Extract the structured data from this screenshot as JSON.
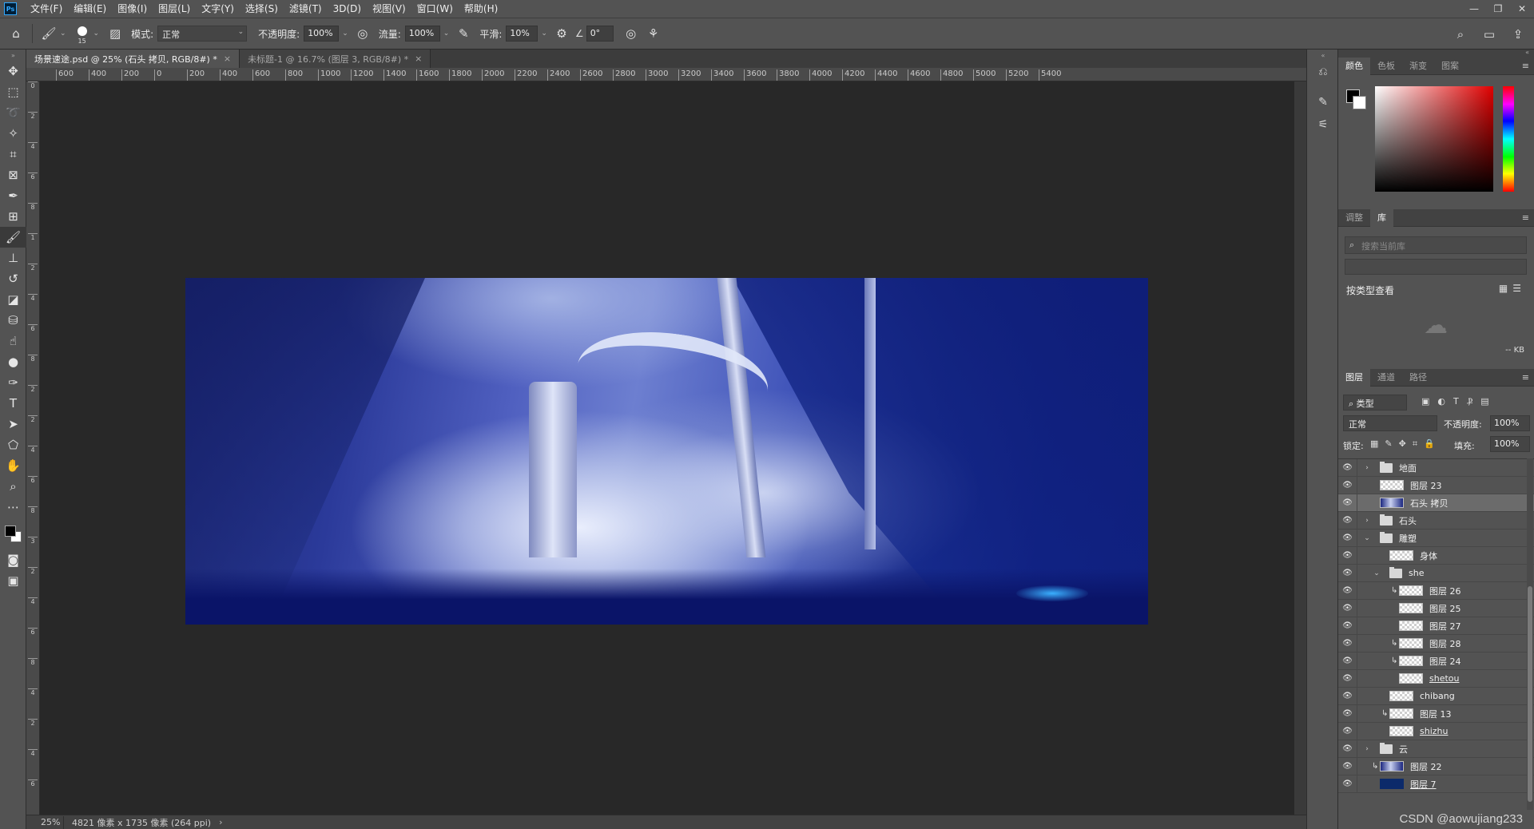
{
  "app": {
    "logo_text": "Ps"
  },
  "menu": [
    "文件(F)",
    "编辑(E)",
    "图像(I)",
    "图层(L)",
    "文字(Y)",
    "选择(S)",
    "滤镜(T)",
    "3D(D)",
    "视图(V)",
    "窗口(W)",
    "帮助(H)"
  ],
  "window_controls": [
    "—",
    "❐",
    "✕"
  ],
  "options": {
    "brush_size": "15",
    "mode_label": "模式:",
    "mode_value": "正常",
    "opacity_label": "不透明度:",
    "opacity_value": "100%",
    "flow_label": "流量:",
    "flow_value": "100%",
    "smooth_label": "平滑:",
    "smooth_value": "10%",
    "angle_value": "0°"
  },
  "tabs": [
    {
      "label": "场景速途.psd @ 25% (石头 拷贝, RGB/8#) *",
      "close": "×"
    },
    {
      "label": "未标题-1 @ 16.7% (图层 3, RGB/8#) *",
      "close": "×"
    }
  ],
  "ruler_h": [
    "600",
    "400",
    "200",
    "0",
    "200",
    "400",
    "600",
    "800",
    "1000",
    "1200",
    "1400",
    "1600",
    "1800",
    "2000",
    "2200",
    "2400",
    "2600",
    "2800",
    "3000",
    "3200",
    "3400",
    "3600",
    "3800",
    "4000",
    "4200",
    "4400",
    "4600",
    "4800",
    "5000",
    "5200",
    "5400"
  ],
  "ruler_v": [
    "0",
    "2",
    "4",
    "6",
    "8",
    "1",
    "2",
    "4",
    "6",
    "8",
    "2",
    "2",
    "4",
    "6",
    "8",
    "3",
    "2",
    "4",
    "6",
    "8",
    "4",
    "2",
    "4",
    "6"
  ],
  "status": {
    "zoom": "25%",
    "info": "4821 像素 x 1735 像素 (264 ppi)",
    "arrow": "›"
  },
  "color_panel": {
    "tabs": [
      "颜色",
      "色板",
      "渐变",
      "图案"
    ]
  },
  "library_panel": {
    "tabs": [
      "调整",
      "库"
    ],
    "search_placeholder": "搜索当前库",
    "view_by": "按类型查看",
    "size": "-- KB"
  },
  "layers_panel": {
    "tabs": [
      "图层",
      "通道",
      "路径"
    ],
    "filter": "类型",
    "blend_mode": "正常",
    "opacity_label": "不透明度:",
    "opacity_value": "100%",
    "lock_label": "锁定:",
    "fill_label": "填充:",
    "fill_value": "100%",
    "layers": [
      {
        "name": "地面",
        "kind": "folder",
        "arrow": "›",
        "indent": 0
      },
      {
        "name": "图层 23",
        "kind": "layer",
        "indent": 0
      },
      {
        "name": "石头 拷贝",
        "kind": "art",
        "indent": 0,
        "selected": true
      },
      {
        "name": "石头",
        "kind": "folder",
        "arrow": "›",
        "indent": 0
      },
      {
        "name": "雕塑",
        "kind": "folder",
        "arrow": "⌄",
        "indent": 0
      },
      {
        "name": "身体",
        "kind": "layer",
        "indent": 1
      },
      {
        "name": "she",
        "kind": "folder",
        "arrow": "⌄",
        "indent": 1
      },
      {
        "name": "图层 26",
        "kind": "layer",
        "indent": 2,
        "clip": true
      },
      {
        "name": "图层 25",
        "kind": "layer",
        "indent": 2
      },
      {
        "name": "图层 27",
        "kind": "layer",
        "indent": 2
      },
      {
        "name": "图层 28",
        "kind": "layer",
        "indent": 2,
        "clip": true
      },
      {
        "name": "图层 24",
        "kind": "layer",
        "indent": 2,
        "clip": true
      },
      {
        "name": "shetou",
        "kind": "layer",
        "indent": 2,
        "underline": true
      },
      {
        "name": "chibang",
        "kind": "layer",
        "indent": 1
      },
      {
        "name": "图层 13",
        "kind": "layer",
        "indent": 1,
        "clip": true
      },
      {
        "name": "shizhu",
        "kind": "layer",
        "indent": 1,
        "underline": true
      },
      {
        "name": "云",
        "kind": "folder",
        "arrow": "›",
        "indent": 0
      },
      {
        "name": "图层 22",
        "kind": "art",
        "indent": 0,
        "clip": true
      },
      {
        "name": "图层 7",
        "kind": "dark",
        "indent": 0,
        "underline": true
      }
    ]
  },
  "watermark": "CSDN @aowujiang233"
}
